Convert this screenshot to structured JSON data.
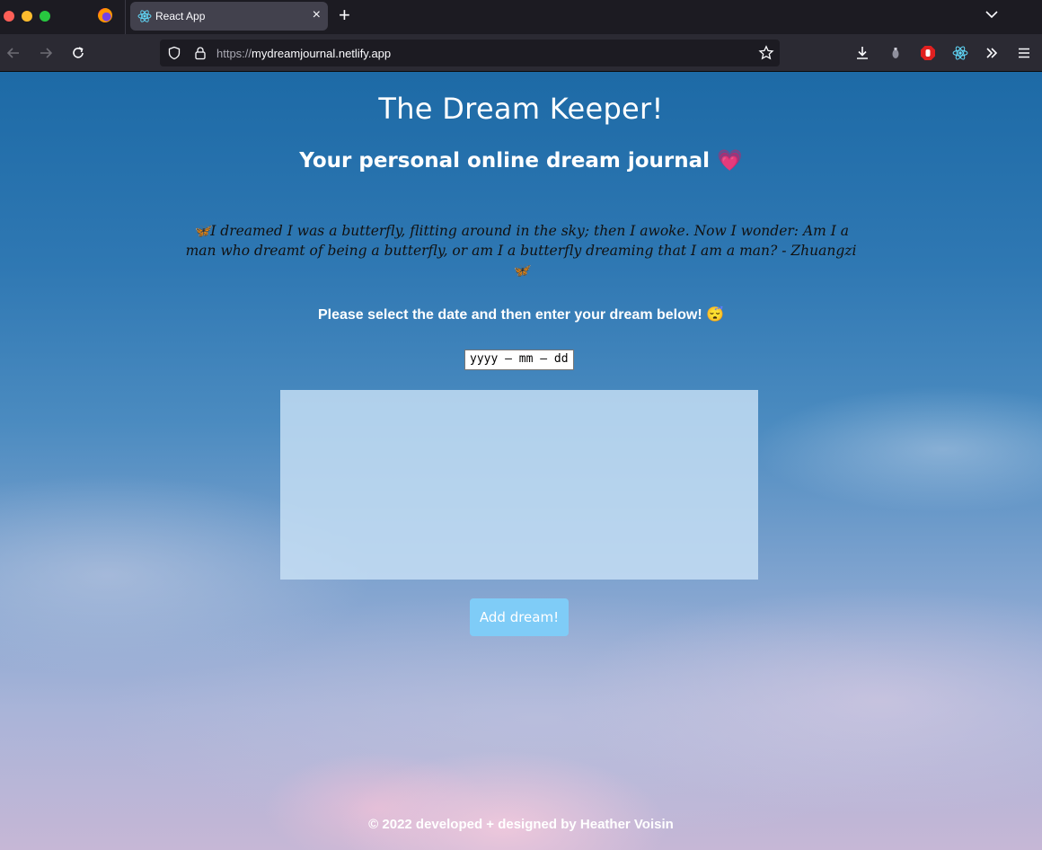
{
  "browser": {
    "tab_title": "React App",
    "tab_close": "×",
    "new_tab": "+",
    "url_protocol": "https://",
    "url_host": "mydreamjournal.netlify.app"
  },
  "page": {
    "title": "The Dream Keeper!",
    "subtitle": "Your personal online dream journal 💗",
    "quote": "🦋I dreamed I was a butterfly, flitting around in the sky; then I awoke. Now I wonder: Am I a man who dreamt of being a butterfly, or am I a butterfly dreaming that I am a man? - Zhuangzi🦋",
    "prompt": "Please select the date and then enter your dream below! 😴",
    "date_placeholder": "yyyy – mm – dd",
    "dream_value": "",
    "add_button": "Add dream!",
    "footer": "© 2022 developed + designed by Heather Voisin"
  },
  "colors": {
    "button_bg": "#7fccf7",
    "tab_active": "#42414d",
    "toolbar": "#2b2a33"
  }
}
